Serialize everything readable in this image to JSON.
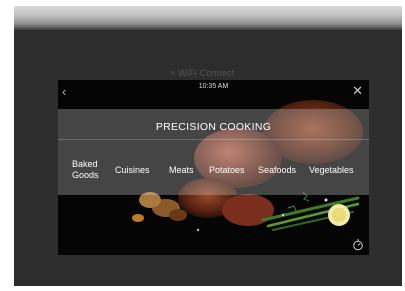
{
  "status": {
    "wifi": "WiFi Connect",
    "time": "10:35 AM"
  },
  "title": "PRECISION COOKING",
  "categories": [
    {
      "line1": "Baked",
      "line2": "Goods"
    },
    {
      "line1": "Cuisines"
    },
    {
      "line1": "Meats"
    },
    {
      "line1": "Potatoes"
    },
    {
      "line1": "Seafoods"
    },
    {
      "line1": "Vegetables"
    }
  ],
  "icons": {
    "back": "chevron-left-icon",
    "close": "close-icon",
    "timer": "timer-icon",
    "wifi": "wifi-icon"
  }
}
